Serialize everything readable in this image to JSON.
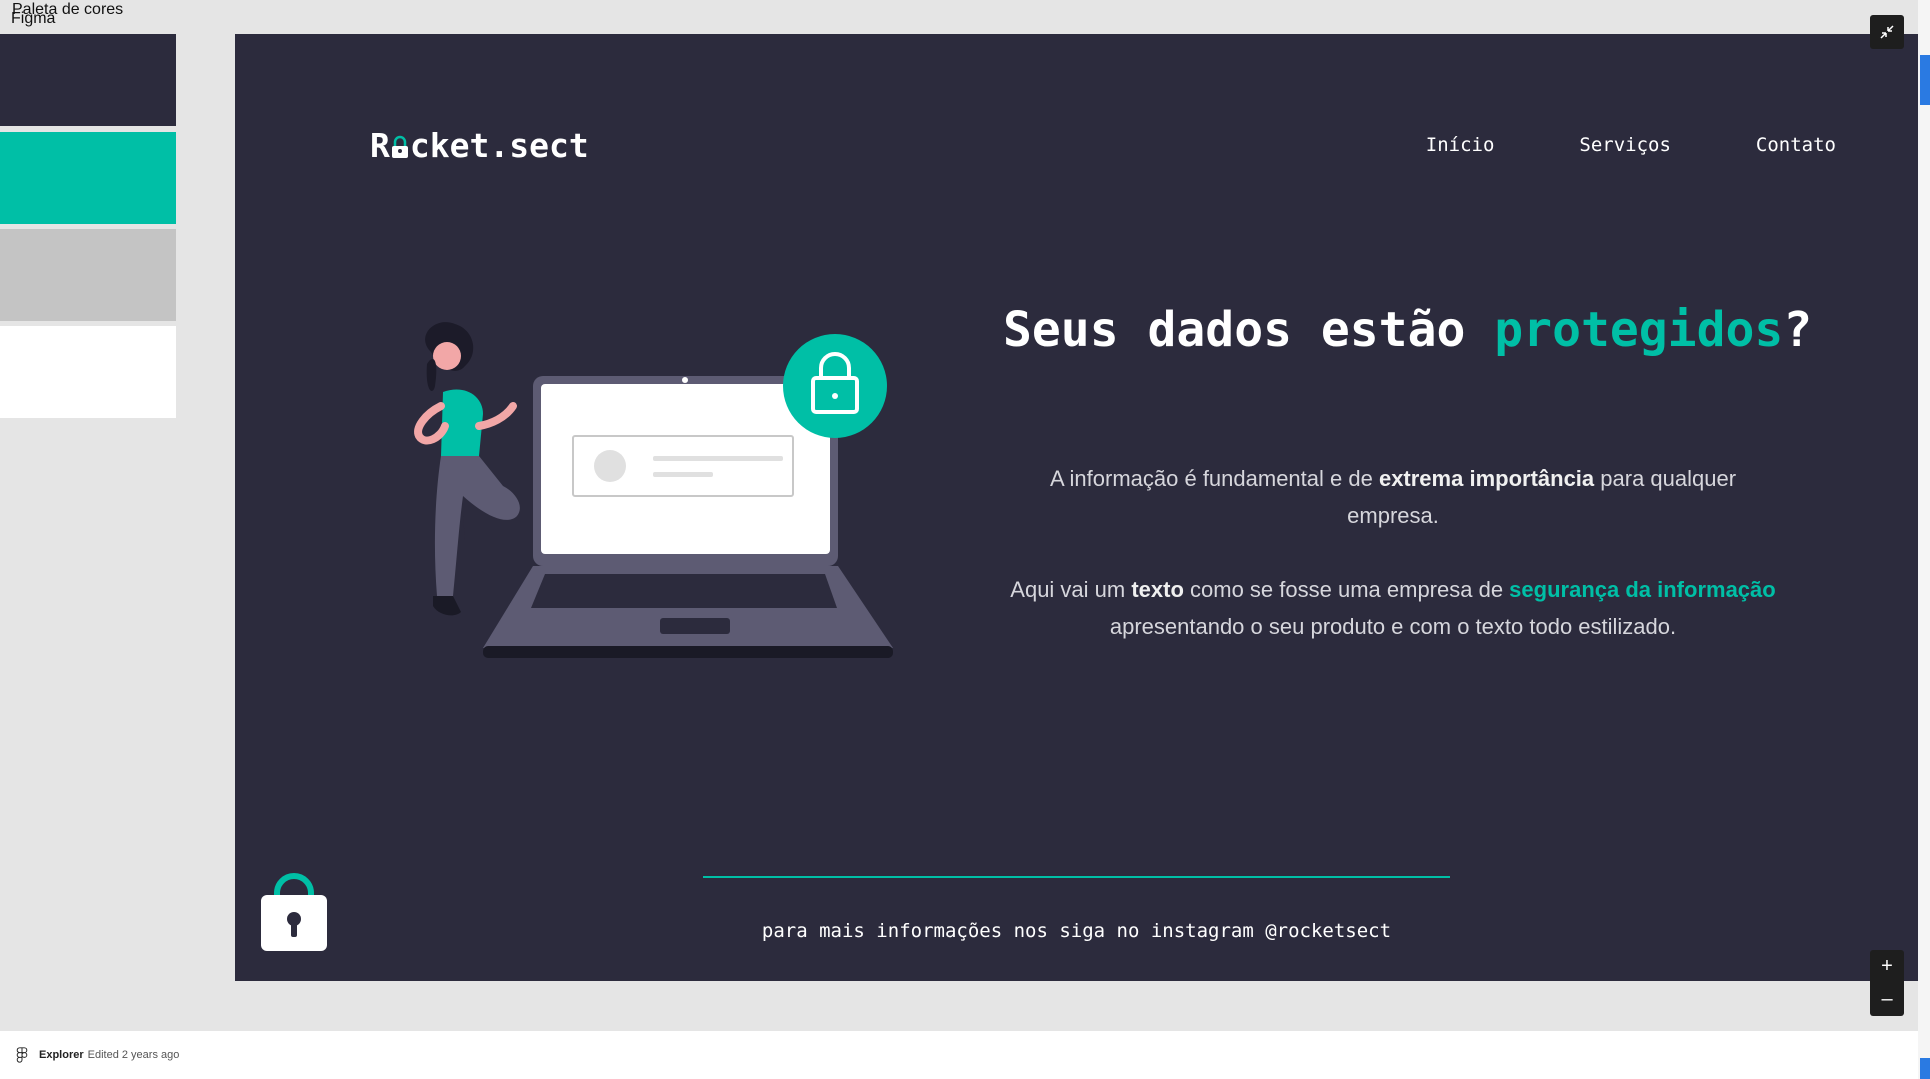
{
  "app": {
    "name": "Figma"
  },
  "palette": {
    "label": "Paleta de cores",
    "colors": [
      "#2c2b3d",
      "#00bfa6",
      "#c4c4c4",
      "#ffffff"
    ]
  },
  "site": {
    "logo": {
      "before": "R",
      "after": "cket.sect"
    },
    "nav": [
      "Início",
      "Serviços",
      "Contato"
    ],
    "headline": {
      "part1": "Seus dados estão ",
      "accent": "protegidos",
      "part2": "?"
    },
    "para1": {
      "t1": "A informação é fundamental e de ",
      "b1": "extrema importância",
      "t2": " para qualquer empresa."
    },
    "para2": {
      "t1": "Aqui vai um ",
      "b1": "texto",
      "t2": " como se fosse uma empresa de ",
      "accent": "segurança da informação",
      "t3": " apresentando o seu produto e com o texto todo estilizado."
    },
    "footer": "para mais informações nos siga no instagram @rocketsect"
  },
  "controls": {
    "zoom_in": "+",
    "zoom_out": "–",
    "collapse_icon": "collapse-icon"
  },
  "status_bar": {
    "owner": "Explorer",
    "edited": "Edited 2 years ago"
  },
  "colors": {
    "background": "#2c2b3d",
    "accent": "#00bfa6",
    "gray": "#c4c4c4",
    "white": "#ffffff"
  }
}
